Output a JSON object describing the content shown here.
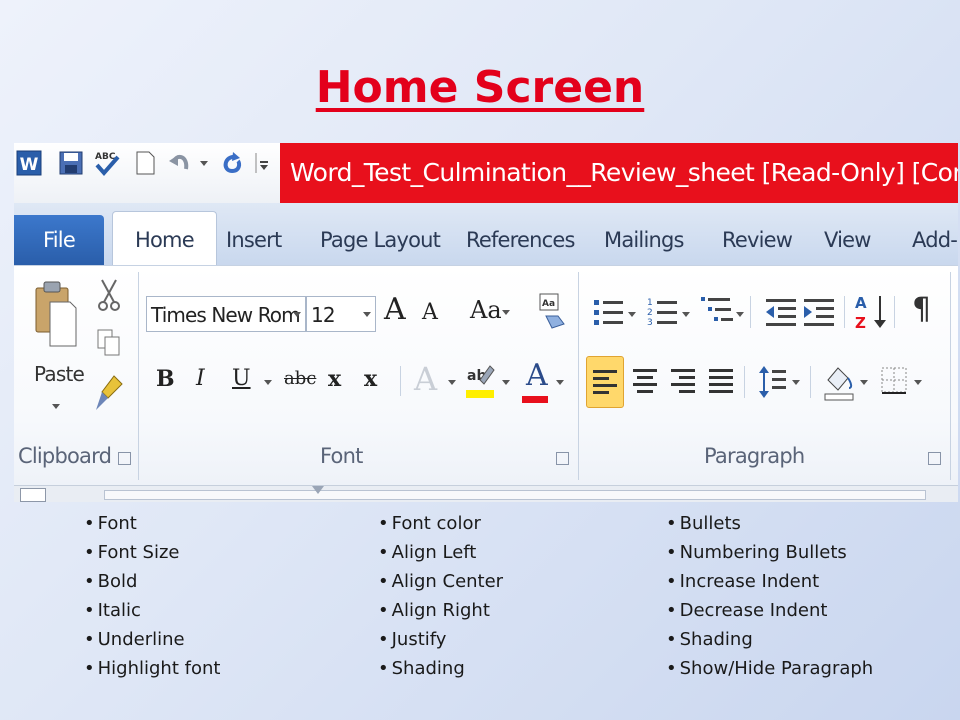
{
  "slide": {
    "title": "Home Screen"
  },
  "window": {
    "title": "Word_Test_Culmination__Review_sheet [Read-Only] [Compatibility Mod",
    "accent": "#e8101c"
  },
  "tabs": [
    "File",
    "Home",
    "Insert",
    "Page Layout",
    "References",
    "Mailings",
    "Review",
    "View",
    "Add-I"
  ],
  "ribbon": {
    "clipboard": {
      "paste_label": "Paste",
      "group_label": "Clipboard"
    },
    "font": {
      "font_name": "Times New Rom",
      "font_size": "12",
      "group_label": "Font",
      "grow": "A",
      "shrink": "A",
      "change_case": "Aa",
      "bold": "B",
      "italic": "I",
      "underline": "U",
      "strike": "abc",
      "subscript": "x",
      "superscript": "x",
      "effects": "A",
      "font_color": "A"
    },
    "paragraph": {
      "group_label": "Paragraph",
      "pilcrow": "¶"
    }
  },
  "lists": {
    "col1": [
      "Font",
      "Font Size",
      "Bold",
      "Italic",
      "Underline",
      "Highlight font"
    ],
    "col2": [
      "Font color",
      "Align Left",
      "Align Center",
      "Align Right",
      "Justify",
      "Shading"
    ],
    "col3": [
      "Bullets",
      "Numbering Bullets",
      "Increase Indent",
      "Decrease Indent",
      "Shading",
      "Show/Hide Paragraph"
    ],
    "bullet": "•"
  },
  "colors": {
    "title_red": "#e3001b",
    "file_tab": "#2a5eaa",
    "highlight_yellow": "#ffef00",
    "font_color_red": "#e8101c"
  }
}
